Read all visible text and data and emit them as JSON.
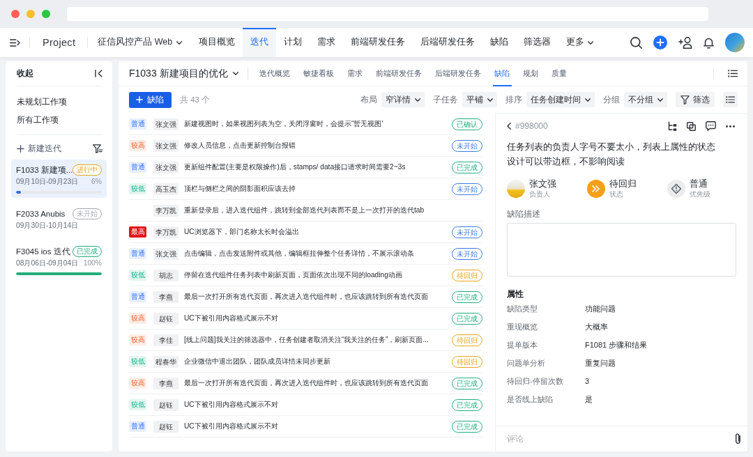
{
  "topnav": {
    "project": "Project",
    "product": "征信风控产品 Web",
    "tabs": [
      {
        "label": "项目概览",
        "selected": false,
        "dropdown": false
      },
      {
        "label": "迭代",
        "selected": true,
        "dropdown": false
      },
      {
        "label": "计划",
        "selected": false,
        "dropdown": false
      },
      {
        "label": "需求",
        "selected": false,
        "dropdown": false
      },
      {
        "label": "前端研发任务",
        "selected": false,
        "dropdown": false
      },
      {
        "label": "后端研发任务",
        "selected": false,
        "dropdown": false
      },
      {
        "label": "缺陷",
        "selected": false,
        "dropdown": false
      },
      {
        "label": "筛选器",
        "selected": false,
        "dropdown": false
      },
      {
        "label": "更多",
        "selected": false,
        "dropdown": true
      }
    ]
  },
  "sidebar": {
    "collapse_label": "收起",
    "links": [
      "未规划工作项",
      "所有工作项"
    ],
    "new_iteration": "新建迭代",
    "iterations": [
      {
        "name": "F1033 新建项...",
        "status": {
          "label": "进行中",
          "color": "#e6a417"
        },
        "dates": "09月10日-09月23日",
        "percent": "6%",
        "progress": {
          "level": 0.06,
          "color": "#2f6fe0"
        },
        "selected": true
      },
      {
        "name": "F2033 Anubis",
        "status": {
          "label": "未开始",
          "color": "#a3a8b0"
        },
        "dates": "09月30日-10月14日",
        "selected": false
      },
      {
        "name": "F3045 ios 迭代",
        "status": {
          "label": "已完成",
          "color": "#1fae7a"
        },
        "dates": "08月06日-09月04日",
        "percent": "100%",
        "progress": {
          "level": 1,
          "color": "#1fae7a"
        },
        "selected": false
      }
    ]
  },
  "main": {
    "title": "F1033 新建项目的优化",
    "tabs": [
      {
        "label": "迭代概览",
        "selected": false
      },
      {
        "label": "敏捷看板",
        "selected": false
      },
      {
        "label": "需求",
        "selected": false
      },
      {
        "label": "前端研发任务",
        "selected": false
      },
      {
        "label": "后端研发任务",
        "selected": false
      },
      {
        "label": "缺陷",
        "selected": true
      },
      {
        "label": "规划",
        "selected": false
      },
      {
        "label": "质量",
        "selected": false
      }
    ],
    "add_button": "缺陷",
    "count": "共 43 个",
    "options": [
      {
        "label": "布局",
        "value": "窄详情"
      },
      {
        "label": "子任务",
        "value": "平铺"
      },
      {
        "label": "排序",
        "value": "任务创建时间"
      },
      {
        "label": "分组",
        "value": "不分组"
      }
    ],
    "filter_button": "筛选",
    "rows": [
      {
        "priority": {
          "label": "普通",
          "kind": "normal"
        },
        "assignee": "张文强",
        "title": "新建视图时，如果视图列表为空，关闭浮窗时，会提示“暂无视图'",
        "status": {
          "label": "已确认",
          "color": "#1fae7a"
        }
      },
      {
        "priority": {
          "label": "较高",
          "kind": "high"
        },
        "assignee": "张文强",
        "title": "修改人员信息，点击更新控制台报错",
        "status": {
          "label": "未开始",
          "color": "#3a7bea"
        }
      },
      {
        "priority": {
          "label": "普通",
          "kind": "normal"
        },
        "assignee": "张文强",
        "title": "更新组件配置(主要是权限操作)后，stamps/ data接口请求时间需要2~3s",
        "status": {
          "label": "已完成",
          "color": "#1fae7a"
        }
      },
      {
        "priority": {
          "label": "较低",
          "kind": "low"
        },
        "assignee": "高玉杰",
        "title": "顶栏与侧栏之间的阴影面积应该去掉",
        "status": {
          "label": "未开始",
          "color": "#3a7bea"
        }
      },
      {
        "assignee": "李万凯",
        "title": "重新登录后，进入迭代组件，跳转到全部迭代列表而不是上一次打开的迭代tab"
      },
      {
        "priority": {
          "label": "最高",
          "kind": "urgent"
        },
        "assignee": "李万凯",
        "title": "UC浏览器下，部门名称太长时会溢出",
        "status": {
          "label": "未开始",
          "color": "#3a7bea"
        }
      },
      {
        "priority": {
          "label": "普通",
          "kind": "normal"
        },
        "assignee": "张文强",
        "title": "点击编辑，点击发送附件或其他，编辑框拉伸整个任务详情，不展示滚动条",
        "status": {
          "label": "未开始",
          "color": "#3a7bea"
        }
      },
      {
        "priority": {
          "label": "较低",
          "kind": "low"
        },
        "assignee": "胡志",
        "title": "停留在迭代组件任务列表中刷新页面，页面依次出现不同的loading动画",
        "status": {
          "label": "待回归",
          "color": "#e6a417"
        }
      },
      {
        "priority": {
          "label": "普通",
          "kind": "normal"
        },
        "assignee": "李燕",
        "title": "最后一次打开所有迭代页面，再次进入迭代组件时，也应该跳转到所有迭代页面",
        "status": {
          "label": "已完成",
          "color": "#1fae7a"
        }
      },
      {
        "priority": {
          "label": "较高",
          "kind": "high"
        },
        "assignee": "赵钰",
        "title": "UC下被引用内容格式展示不对",
        "status": {
          "label": "已完成",
          "color": "#1fae7a"
        }
      },
      {
        "priority": {
          "label": "较高",
          "kind": "high"
        },
        "assignee": "李佳",
        "title": "[线上问题]我关注的筛选器中，任务创建者取消关注“我关注的任务”，刷新页面...",
        "status": {
          "label": "待回归",
          "color": "#e6a417"
        }
      },
      {
        "priority": {
          "label": "较低",
          "kind": "low"
        },
        "assignee": "程春华",
        "title": "企业微信中退出团队，团队成员详情未同步更新",
        "status": {
          "label": "待回归",
          "color": "#e6a417"
        }
      },
      {
        "priority": {
          "label": "较高",
          "kind": "high"
        },
        "assignee": "李燕",
        "title": "最后一次打开所有迭代页面，再次进入迭代组件时，也应该跳转到所有迭代页面",
        "status": {
          "label": "已完成",
          "color": "#1fae7a"
        }
      },
      {
        "priority": {
          "label": "较低",
          "kind": "low"
        },
        "assignee": "赵钰",
        "title": "UC下被引用内容格式展示不对",
        "status": {
          "label": "已完成",
          "color": "#1fae7a"
        }
      },
      {
        "priority": {
          "label": "普通",
          "kind": "normal"
        },
        "assignee": "赵钰",
        "title": "UC下被引用内容格式展示不对",
        "status": {
          "label": "已完成",
          "color": "#1fae7a"
        }
      }
    ]
  },
  "detail": {
    "id": "#998000",
    "title": "任务列表的负责人字号不要太小，列表上属性的状态设计可以带边框，不影响阅读",
    "meta": [
      {
        "kind": "assignee",
        "value": "张文强",
        "caption": "负责人"
      },
      {
        "kind": "status",
        "value": "待回归",
        "caption": "状态"
      },
      {
        "kind": "priority",
        "value": "普通",
        "caption": "优先级"
      }
    ],
    "description_label": "缺陷描述",
    "properties_title": "属性",
    "properties": [
      {
        "label": "缺陷类型",
        "value": "功能问题"
      },
      {
        "label": "重现概览",
        "value": "大概率"
      },
      {
        "label": "提单版本",
        "value": "F1081 步骤和结果"
      },
      {
        "label": "问题单分析",
        "value": "重复问题"
      },
      {
        "label": "待回归-停留次数",
        "value": "3"
      },
      {
        "label": "是否线上缺陷",
        "value": "是"
      }
    ],
    "comment_placeholder": "评论"
  }
}
